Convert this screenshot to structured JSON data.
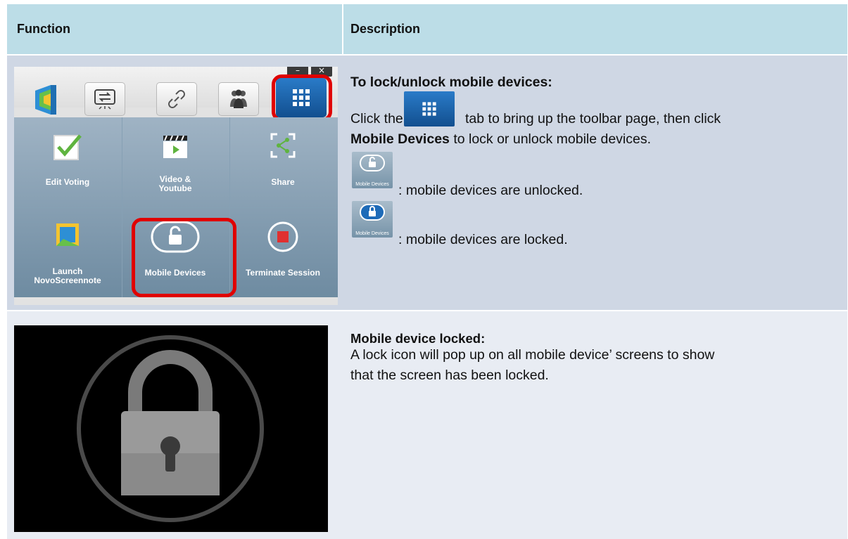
{
  "header": {
    "function_label": "Function",
    "description_label": "Description"
  },
  "row1": {
    "heading": "To lock/unlock mobile devices:",
    "text_click": "Click the",
    "text_after_icon": "tab to bring up the toolbar page, then click",
    "text_bold": "Mobile Devices",
    "text_end": "to lock or unlock mobile devices.",
    "unlocked_text": ": mobile devices are unlocked.",
    "locked_text": ": mobile devices are locked.",
    "icon_caption": "Mobile Devices",
    "app": {
      "min_label": "–",
      "close_label": "×",
      "cells": {
        "edit_voting": "Edit Voting",
        "video_line1": "Video &",
        "video_line2": "Youtube",
        "share": "Share",
        "launch_line1": "Launch",
        "launch_line2": "NovoScreennote",
        "mobile_devices": "Mobile Devices",
        "terminate": "Terminate Session"
      }
    }
  },
  "row2": {
    "heading": "Mobile device locked:",
    "line1": "A lock icon will pop up on all mobile device’ screens to show",
    "line2": "that the screen has been locked."
  },
  "colors": {
    "header_bg": "#bcdde7",
    "row1_bg": "#cfd7e4",
    "row2_bg": "#e8ecf3",
    "highlight": "#e00000",
    "accent_blue": "#1e6bb8"
  }
}
